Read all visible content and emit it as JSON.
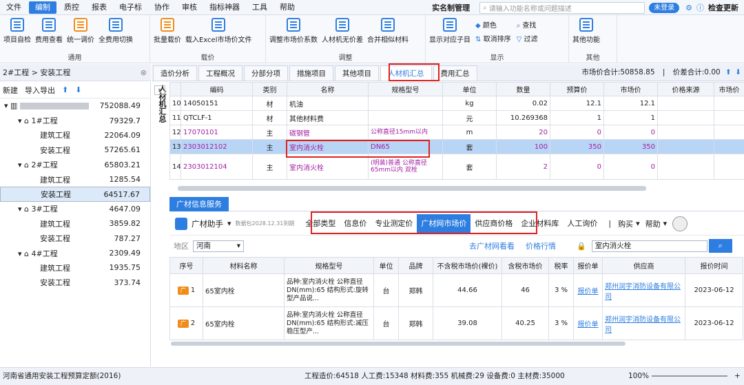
{
  "menu": {
    "items": [
      "文件",
      "编制",
      "质控",
      "报表",
      "电子标",
      "协作",
      "审核",
      "指标神器",
      "工具",
      "帮助"
    ],
    "realname": "实名制管理",
    "search_placeholder": "请输入功能名称或问题描述",
    "login": "未登录",
    "update": "检查更新"
  },
  "toolbar": {
    "g1": {
      "label": "通用",
      "btns": [
        "项目自检",
        "费用查看",
        "统一调价",
        "全费用切换"
      ]
    },
    "g2": {
      "label": "载价",
      "btns": [
        "批量载价",
        "载入Excel市场价文件"
      ]
    },
    "g3": {
      "label": "调整",
      "btns": [
        "调整市场价系数",
        "人材机无价差",
        "合并相似材料"
      ]
    },
    "g4": {
      "label": "显示",
      "btns": [
        "显示对应子目"
      ],
      "small": [
        "颜色",
        "取消排序",
        "查找",
        "过滤"
      ]
    },
    "g5": {
      "label": "其他",
      "btns": [
        "其他功能"
      ]
    }
  },
  "breadcrumb": "2#工程 > 安装工程",
  "tabs": [
    "造价分析",
    "工程概况",
    "分部分项",
    "措施项目",
    "其他项目",
    "人材机汇总",
    "费用汇总"
  ],
  "stats": {
    "market": "市场价合计:50858.85",
    "diff": "价差合计:0.00"
  },
  "left": {
    "new": "新建",
    "import": "导入导出",
    "tree": [
      {
        "label": "",
        "value": "752088.49",
        "level": 0
      },
      {
        "label": "1#工程",
        "value": "79329.7",
        "level": 1
      },
      {
        "label": "建筑工程",
        "value": "22064.09",
        "level": 2
      },
      {
        "label": "安装工程",
        "value": "57265.61",
        "level": 2
      },
      {
        "label": "2#工程",
        "value": "65803.21",
        "level": 1
      },
      {
        "label": "建筑工程",
        "value": "1285.54",
        "level": 2
      },
      {
        "label": "安装工程",
        "value": "64517.67",
        "level": 2,
        "selected": true
      },
      {
        "label": "3#工程",
        "value": "4647.09",
        "level": 1
      },
      {
        "label": "建筑工程",
        "value": "3859.82",
        "level": 2
      },
      {
        "label": "安装工程",
        "value": "787.27",
        "level": 2
      },
      {
        "label": "4#工程",
        "value": "2309.49",
        "level": 1
      },
      {
        "label": "建筑工程",
        "value": "1935.75",
        "level": 2
      },
      {
        "label": "安装工程",
        "value": "373.74",
        "level": 2
      }
    ]
  },
  "vtitle": "人材机汇总",
  "grid": {
    "headers": [
      "",
      "编码",
      "类别",
      "名称",
      "规格型号",
      "单位",
      "数量",
      "预算价",
      "市场价",
      "价格来源",
      "市场价"
    ],
    "rows": [
      [
        "10",
        "14050151",
        "材",
        "机油",
        "",
        "kg",
        "0.02",
        "12.1",
        "12.1",
        "",
        ""
      ],
      [
        "11",
        "QTCLF-1",
        "材",
        "其他材料费",
        "",
        "元",
        "10.269368",
        "1",
        "1",
        "",
        ""
      ],
      [
        "12",
        "17070101",
        "主",
        "碳钢管",
        "公称直径15mm以内",
        "m",
        "20",
        "0",
        "0",
        "",
        ""
      ],
      [
        "13",
        "2303012102",
        "主",
        "室内消火栓",
        "DN65",
        "套",
        "100",
        "350",
        "350",
        "",
        ""
      ],
      [
        "14",
        "2303012104",
        "主",
        "室内消火栓",
        "(明装)普通 公称直径65mm以内 双栓",
        "套",
        "2",
        "0",
        "0",
        "",
        ""
      ]
    ]
  },
  "service": {
    "tab": "广材信息服务",
    "assistant": "广材助手",
    "expiry": "数据包2028.12.31到期",
    "filters": [
      "全部类型",
      "信息价",
      "专业测定价",
      "广材网市场价",
      "供应商价格",
      "企业材料库",
      "人工询价"
    ],
    "buy": "购买",
    "help": "帮助",
    "region_label": "地区",
    "region": "河南",
    "goto": "去广材网看看",
    "trend": "价格行情",
    "keyword": "室内消火栓",
    "headers": [
      "序号",
      "材料名称",
      "规格型号",
      "单位",
      "品牌",
      "不含税市场价(裸价)",
      "含税市场价",
      "税率",
      "报价单",
      "供应商",
      "报价时间"
    ],
    "rows": [
      {
        "no": "1",
        "name": "65室内栓",
        "spec": "品种:室内消火栓 公称直径DN(mm):65 结构形式:旋转型产品说...",
        "unit": "台",
        "brand": "郑韩",
        "price": "44.66",
        "tax_price": "46",
        "rate": "3 %",
        "quote": "报价单",
        "supplier": "郑州润宇消防设备有限公司",
        "date": "2023-06-12"
      },
      {
        "no": "2",
        "name": "65室内栓",
        "spec": "品种:室内消火栓 公称直径DN(mm):65 结构形式:减压稳压型产...",
        "unit": "台",
        "brand": "郑韩",
        "price": "39.08",
        "tax_price": "40.25",
        "rate": "3 %",
        "quote": "报价单",
        "supplier": "郑州润宇消防设备有限公司",
        "date": "2023-06-12"
      }
    ]
  },
  "status": {
    "left": "河南省通用安装工程预算定额(2016)",
    "totals": "工程造价:64518  人工费:15348  材料费:355  机械费:29  设备费:0  主材费:35000",
    "zoom": "100%"
  }
}
